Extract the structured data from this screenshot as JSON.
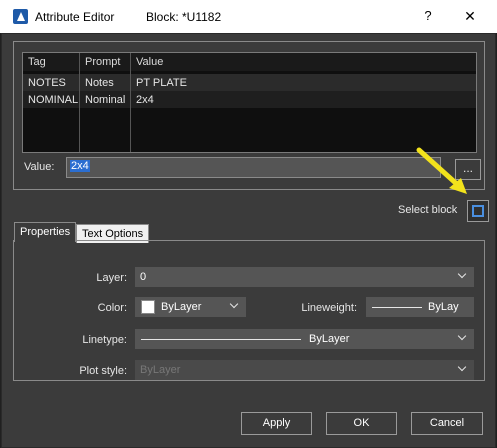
{
  "window": {
    "title": "Attribute Editor",
    "block_label": "Block: *U1182",
    "help": "?",
    "close": "✕"
  },
  "table": {
    "headers": [
      "Tag",
      "Prompt",
      "Value"
    ],
    "rows": [
      {
        "tag": "NOTES",
        "prompt": "Notes",
        "value": "PT PLATE"
      },
      {
        "tag": "NOMINAL",
        "prompt": "Nominal",
        "value": "2x4"
      }
    ]
  },
  "value_field": {
    "label": "Value:",
    "value": "2x4",
    "ellipsis": "..."
  },
  "select_block": {
    "label": "Select block",
    "icon": "select-block-icon"
  },
  "tabs": {
    "properties": "Properties",
    "text_options": "Text Options"
  },
  "properties": {
    "layer_label": "Layer:",
    "layer_value": "0",
    "color_label": "Color:",
    "color_value": "ByLayer",
    "color_swatch": "#ffffff",
    "lineweight_label": "Lineweight:",
    "lineweight_value": "ByLay",
    "linetype_label": "Linetype:",
    "linetype_value": "ByLayer",
    "plotstyle_label": "Plot style:",
    "plotstyle_value": "ByLayer"
  },
  "buttons": {
    "apply": "Apply",
    "ok": "OK",
    "cancel": "Cancel"
  },
  "colors": {
    "dialog_bg": "#3b3b3b",
    "selection": "#2b6ed1",
    "highlight_arrow": "#f2e21c"
  }
}
